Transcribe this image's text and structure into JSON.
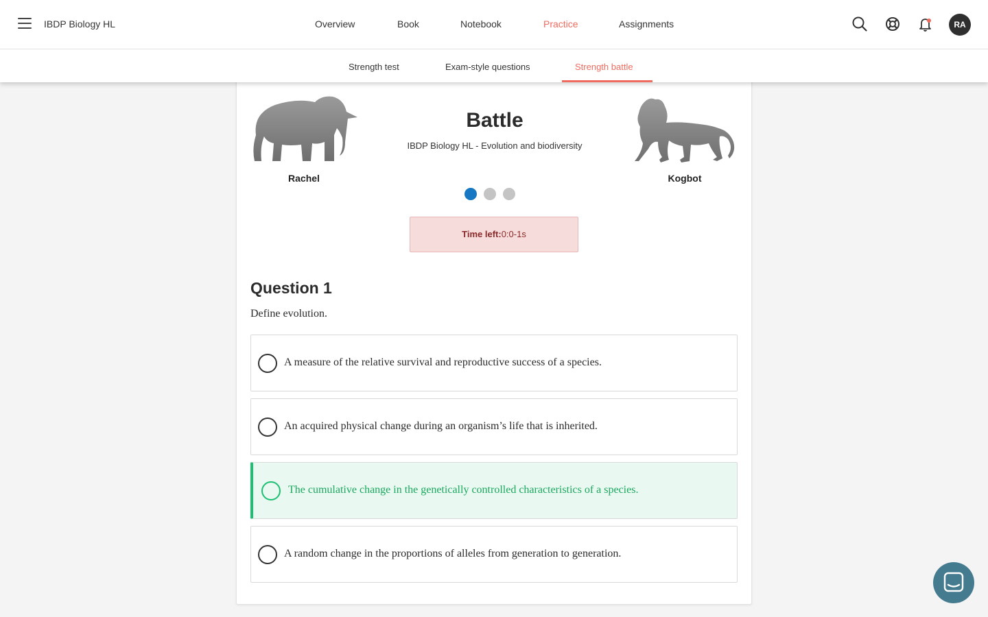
{
  "header": {
    "course_title": "IBDP Biology HL",
    "nav": [
      "Overview",
      "Book",
      "Notebook",
      "Practice",
      "Assignments"
    ],
    "active_nav": "Practice",
    "avatar_initials": "RA"
  },
  "subnav": {
    "items": [
      "Strength test",
      "Exam-style questions",
      "Strength battle"
    ],
    "active": "Strength battle"
  },
  "battle": {
    "title": "Battle",
    "subtitle": "IBDP Biology HL - Evolution and biodiversity",
    "player_left": "Rachel",
    "player_right": "Kogbot",
    "progress_current": 1,
    "progress_total": 3,
    "timer_label": "Time left:",
    "timer_value": "0:0-1s"
  },
  "question": {
    "title": "Question 1",
    "text": "Define evolution.",
    "options": [
      "A measure of the relative survival and reproductive success of a species.",
      "An acquired physical change during an organism’s life that is inherited.",
      "The cumulative change in the genetically controlled characteristics of a species.",
      "A random change in the proportions of alleles from generation to generation."
    ],
    "correct_index": 2
  },
  "colors": {
    "accent": "#f06b5e",
    "progress_active": "#1678c2",
    "correct": "#1dbf73",
    "timer_bg": "#f7dcdc",
    "chat": "#447b8f"
  },
  "icons": [
    "menu-icon",
    "search-icon",
    "help-lifebuoy-icon",
    "notification-bell-icon",
    "elephant-icon",
    "lion-icon",
    "chat-icon"
  ]
}
